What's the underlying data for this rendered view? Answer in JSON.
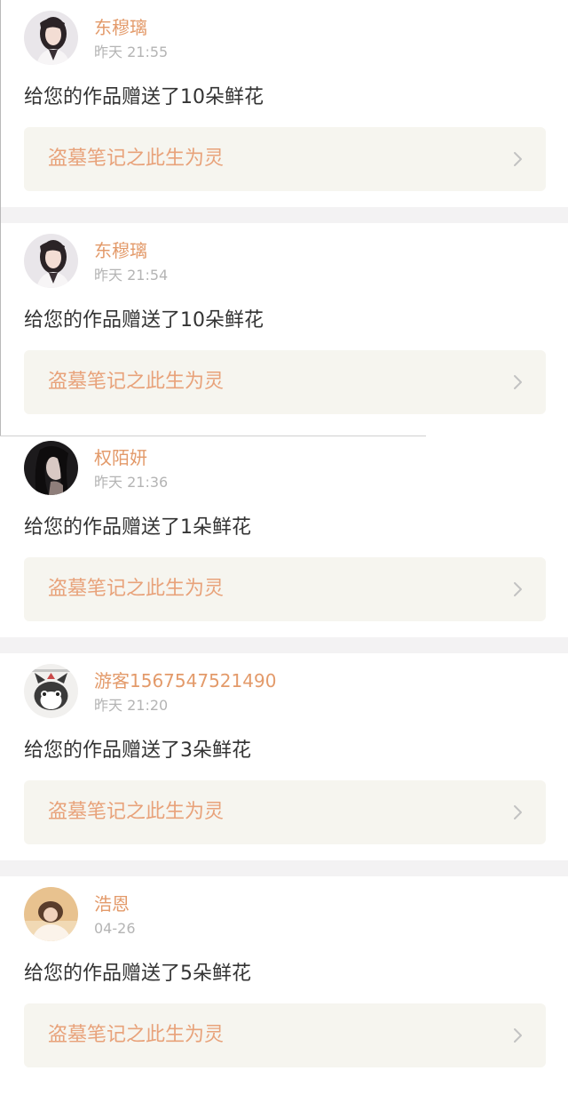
{
  "notifications": [
    {
      "user": "东穆璃",
      "time": "昨天 21:55",
      "message": "给您的作品赠送了10朵鲜花",
      "work_title": "盗墓笔记之此生为灵",
      "avatar": "girl-portrait-avatar"
    },
    {
      "user": "东穆璃",
      "time": "昨天 21:54",
      "message": "给您的作品赠送了10朵鲜花",
      "work_title": "盗墓笔记之此生为灵",
      "avatar": "girl-portrait-avatar"
    },
    {
      "user": "权陌妍",
      "time": "昨天 21:36",
      "message": "给您的作品赠送了1朵鲜花",
      "work_title": "盗墓笔记之此生为灵",
      "avatar": "dark-haired-girl-avatar"
    },
    {
      "user": "游客1567547521490",
      "time": "昨天 21:20",
      "message": "给您的作品赠送了3朵鲜花",
      "work_title": "盗墓笔记之此生为灵",
      "avatar": "cartoon-cat-avatar"
    },
    {
      "user": "浩恩",
      "time": "04-26",
      "message": "给您的作品赠送了5朵鲜花",
      "work_title": "盗墓笔记之此生为灵",
      "avatar": "warm-portrait-avatar"
    }
  ],
  "colors": {
    "username": "#e39a6a",
    "work_title": "#e8a27a",
    "link_background": "#f6f5ef",
    "separator": "#f3f2f3"
  },
  "icons": {
    "link_arrow": "chevron-right-icon"
  }
}
